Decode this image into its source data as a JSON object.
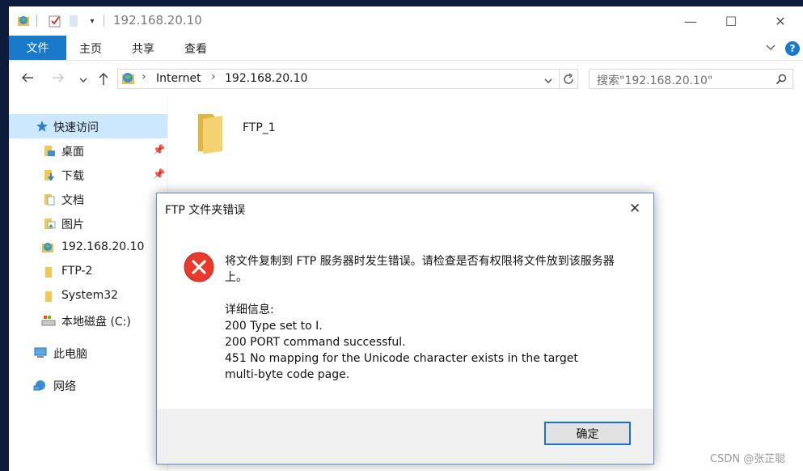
{
  "window": {
    "title": "192.168.20.10",
    "minimize": "—",
    "maximize": "☐",
    "close": "✕"
  },
  "ribbon": {
    "file_tab": "文件",
    "tabs": [
      "主页",
      "共享",
      "查看"
    ]
  },
  "address": {
    "crumbs": [
      "Internet",
      "192.168.20.10"
    ]
  },
  "search": {
    "placeholder": "搜索\"192.168.20.10\""
  },
  "nav_pane": {
    "quick_access": "快速访问",
    "items": [
      {
        "label": "桌面",
        "pinned": true
      },
      {
        "label": "下载",
        "pinned": true
      },
      {
        "label": "文档",
        "pinned": true
      },
      {
        "label": "图片",
        "pinned": true
      },
      {
        "label": "192.168.20.10",
        "pinned": false
      },
      {
        "label": "FTP-2",
        "pinned": false
      },
      {
        "label": "System32",
        "pinned": false
      },
      {
        "label": "本地磁盘 (C:)",
        "pinned": false
      }
    ],
    "this_pc": "此电脑",
    "network": "网络"
  },
  "content": {
    "folders": [
      {
        "name": "FTP_1"
      }
    ]
  },
  "dialog": {
    "title": "FTP 文件夹错误",
    "message": "将文件复制到 FTP 服务器时发生错误。请检查是否有权限将文件放到该服务器上。",
    "details_heading": "详细信息:",
    "details": [
      "200 Type set to I.",
      "200 PORT command successful.",
      "451 No mapping for the Unicode character exists in the target",
      "multi-byte code page."
    ],
    "ok_label": "确定"
  },
  "watermark": "CSDN @张芷聪",
  "colors": {
    "accent": "#1979ca",
    "selection": "#cce8ff",
    "error_red": "#e8392a",
    "folder_yellow": "#f0c856",
    "desktop_bg": "#0c1c3a"
  }
}
